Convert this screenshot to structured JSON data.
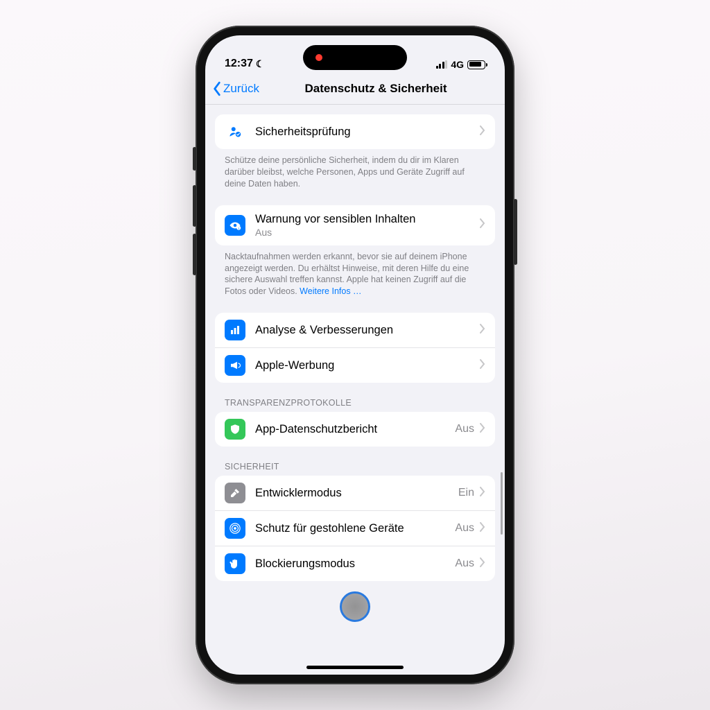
{
  "status": {
    "time": "12:37",
    "network": "4G"
  },
  "nav": {
    "back": "Zurück",
    "title": "Datenschutz & Sicherheit"
  },
  "rows": {
    "safetyCheck": {
      "title": "Sicherheitsprüfung"
    },
    "safetyCheckFooter": "Schütze deine persönliche Sicherheit, indem du dir im Klaren darüber bleibst, welche Personen, Apps und Geräte Zugriff auf deine Daten haben.",
    "sensitiveWarning": {
      "title": "Warnung vor sensiblen Inhalten",
      "value": "Aus"
    },
    "sensitiveFooterA": "Nacktaufnahmen werden erkannt, bevor sie auf deinem iPhone angezeigt werden. Du erhältst Hinweise, mit deren Hilfe du eine sichere Auswahl treffen kannst. Apple hat keinen Zugriff auf die Fotos oder Videos. ",
    "sensitiveFooterLink": "Weitere Infos …",
    "analytics": {
      "title": "Analyse & Verbesserungen"
    },
    "ads": {
      "title": "Apple-Werbung"
    },
    "transHeader": "TRANSPARENZPROTOKOLLE",
    "appReport": {
      "title": "App-Datenschutzbericht",
      "value": "Aus"
    },
    "secHeader": "SICHERHEIT",
    "devMode": {
      "title": "Entwicklermodus",
      "value": "Ein"
    },
    "stolenProtect": {
      "title": "Schutz für gestohlene Geräte",
      "value": "Aus"
    },
    "lockdown": {
      "title": "Blockierungsmodus",
      "value": "Aus"
    }
  }
}
